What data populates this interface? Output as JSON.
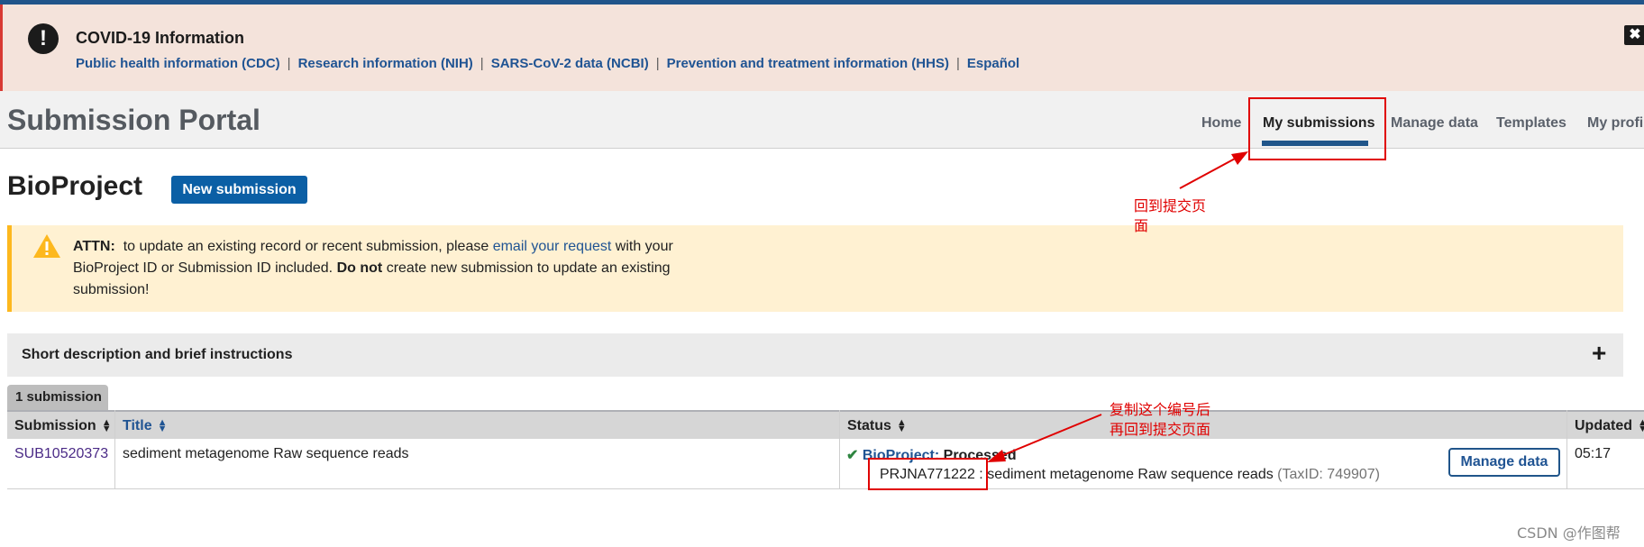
{
  "covid": {
    "title": "COVID-19 Information",
    "links": [
      "Public health information (CDC)",
      "Research information (NIH)",
      "SARS-CoV-2 data (NCBI)",
      "Prevention and treatment information (HHS)",
      "Español"
    ],
    "separator": "|",
    "close": "✖",
    "icon_glyph": "!"
  },
  "header": {
    "title": "Submission Portal",
    "nav": [
      "Home",
      "My submissions",
      "Manage data",
      "Templates",
      "My profil"
    ]
  },
  "page": {
    "title": "BioProject",
    "new_button": "New submission"
  },
  "attn": {
    "label": "ATTN:",
    "text1": "to update an existing record or recent submission, please",
    "link": "email your request",
    "text2": "with your BioProject ID or Submission ID included.",
    "bold": "Do not",
    "text3": "create new submission to update an existing submission!"
  },
  "short": {
    "label": "Short description and brief instructions",
    "plus": "+"
  },
  "table": {
    "count_tab": "1 submission",
    "headers": [
      "Submission",
      "Title",
      "Status",
      "Updated"
    ],
    "row": {
      "id": "SUB10520373",
      "title": "sediment metagenome Raw sequence reads",
      "status_label": "BioProject:",
      "status_value": "Processed",
      "accession": "PRJNA771222",
      "colon": ":",
      "desc": "sediment metagenome Raw sequence reads",
      "taxid": "(TaxID: 749907)",
      "manage": "Manage data",
      "updated": "05:17"
    }
  },
  "annotations": {
    "note1_line1": "回到提交页",
    "note1_line2": "面",
    "note2_line1": "复制这个编号后",
    "note2_line2": "再回到提交页面",
    "color": "#e00000"
  },
  "watermark": "CSDN @作图帮"
}
